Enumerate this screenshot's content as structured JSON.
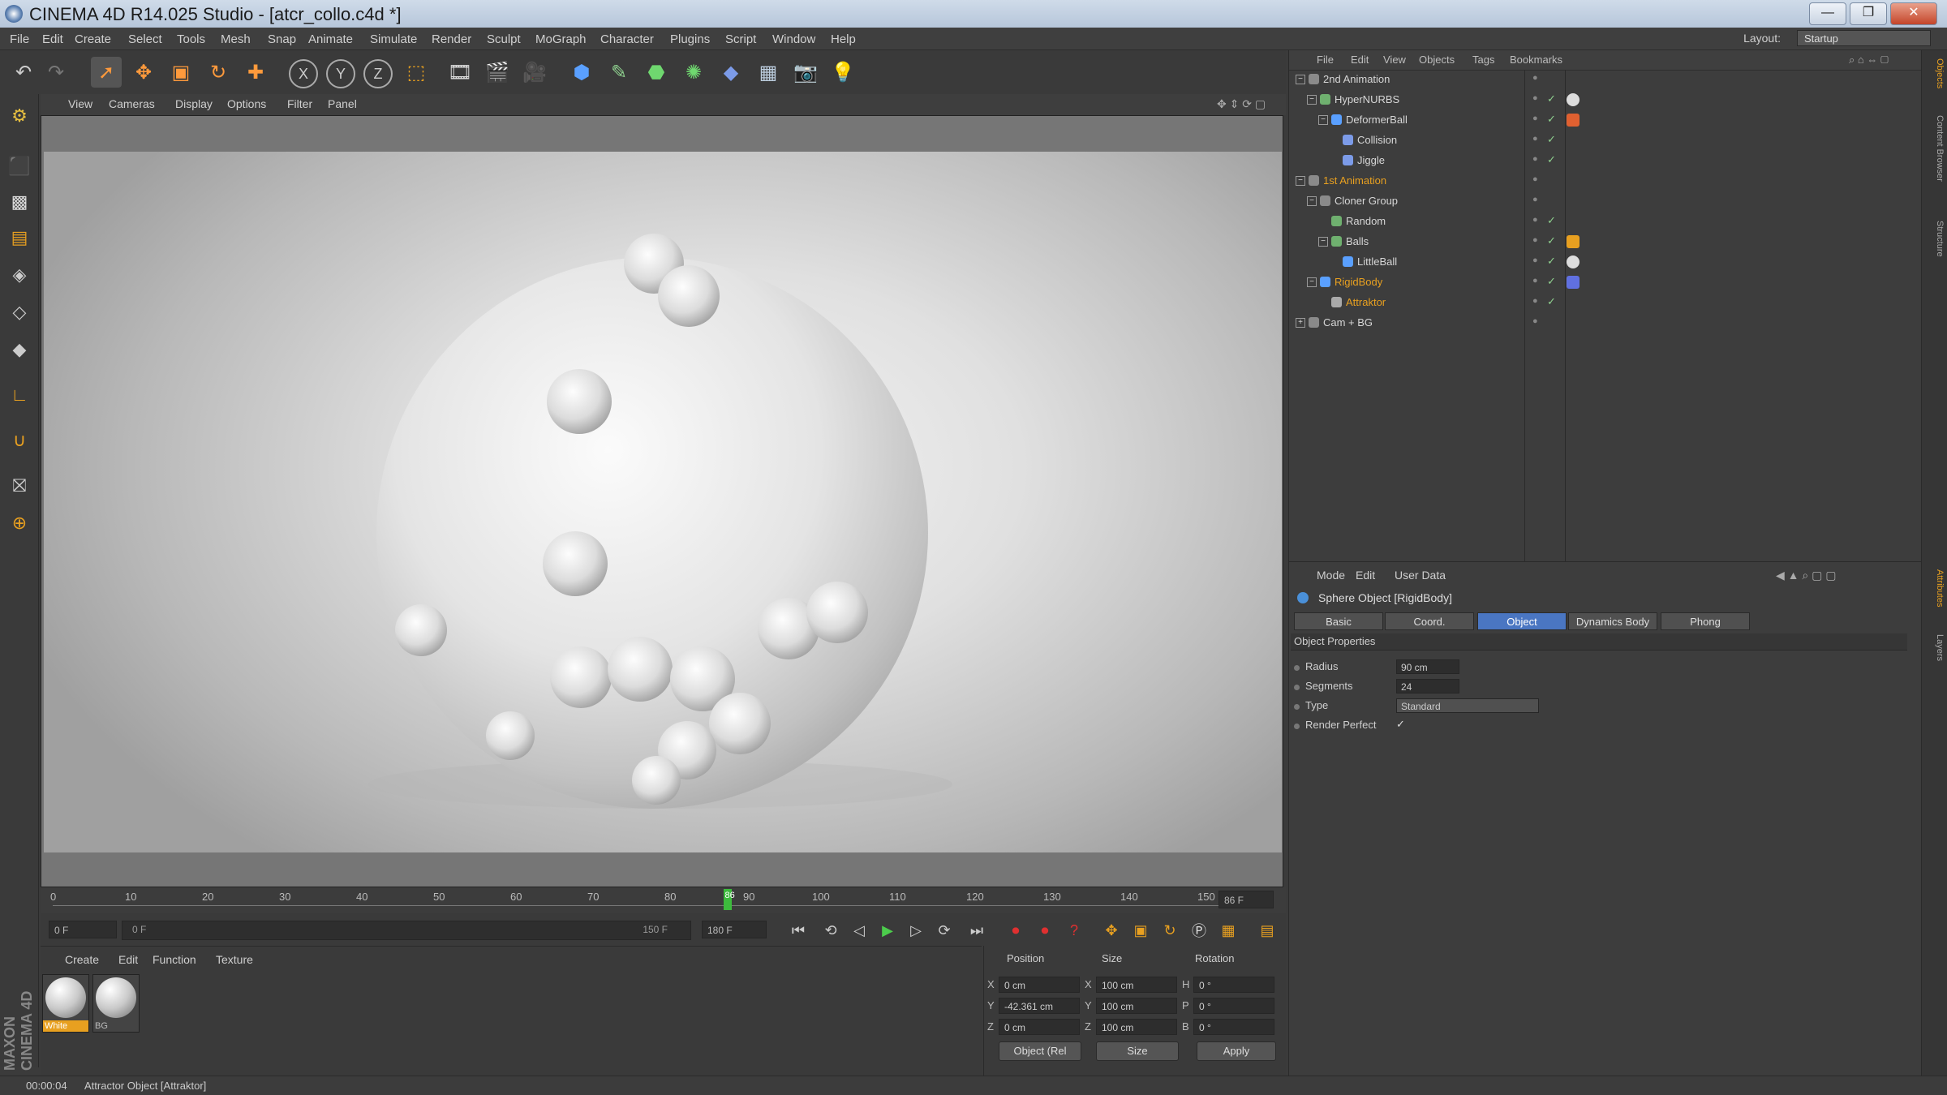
{
  "window": {
    "title": "CINEMA 4D R14.025 Studio - [atcr_collo.c4d *]",
    "minimize": "—",
    "maximize": "❐",
    "close": "✕"
  },
  "menubar": {
    "items": [
      "File",
      "Edit",
      "Create",
      "Select",
      "Tools",
      "Mesh",
      "Snap",
      "Animate",
      "Simulate",
      "Render",
      "Sculpt",
      "MoGraph",
      "Character",
      "Plugins",
      "Script",
      "Window",
      "Help"
    ],
    "layout_label": "Layout:",
    "layout_value": "Startup"
  },
  "viewport": {
    "menu": [
      "View",
      "Cameras",
      "Display",
      "Options",
      "Filter",
      "Panel"
    ]
  },
  "timeline": {
    "ticks": [
      "0",
      "10",
      "20",
      "30",
      "40",
      "50",
      "60",
      "70",
      "80",
      "86",
      "90",
      "100",
      "110",
      "120",
      "130",
      "140",
      "150"
    ],
    "current_frame_label": "86",
    "current_frame_fraction": 0.57,
    "end_field": "86 F",
    "start_field": "0 F",
    "range_start": "0 F",
    "range_end": "150 F",
    "max_field": "180 F"
  },
  "materials": {
    "menu": [
      "Create",
      "Edit",
      "Function",
      "Texture"
    ],
    "items": [
      {
        "label": "White",
        "selected": true
      },
      {
        "label": "BG",
        "selected": false
      }
    ]
  },
  "maxon_logo": "MAXON CINEMA 4D",
  "coordinates": {
    "headers": [
      "Position",
      "Size",
      "Rotation"
    ],
    "rows": [
      {
        "axis": "X",
        "pos": "0 cm",
        "size_axis": "X",
        "size": "100 cm",
        "rot_axis": "H",
        "rot": "0 °"
      },
      {
        "axis": "Y",
        "pos": "-42.361 cm",
        "size_axis": "Y",
        "size": "100 cm",
        "rot_axis": "P",
        "rot": "0 °"
      },
      {
        "axis": "Z",
        "pos": "0 cm",
        "size_axis": "Z",
        "size": "100 cm",
        "rot_axis": "B",
        "rot": "0 °"
      }
    ],
    "mode_select": "Object (Rel",
    "size_select": "Size",
    "apply": "Apply"
  },
  "status": {
    "time": "00:00:04",
    "message": "Attractor Object [Attraktor]"
  },
  "object_manager": {
    "menu": [
      "File",
      "Edit",
      "View",
      "Objects",
      "Tags",
      "Bookmarks"
    ],
    "rows": [
      {
        "label": "2nd Animation",
        "indent": 0,
        "expander": "−",
        "highlight": false
      },
      {
        "label": "HyperNURBS",
        "indent": 1,
        "expander": "−",
        "highlight": false
      },
      {
        "label": "DeformerBall",
        "indent": 2,
        "expander": "−",
        "highlight": false
      },
      {
        "label": "Collision",
        "indent": 3,
        "expander": "",
        "highlight": false
      },
      {
        "label": "Jiggle",
        "indent": 3,
        "expander": "",
        "highlight": false
      },
      {
        "label": "1st Animation",
        "indent": 0,
        "expander": "−",
        "highlight": true
      },
      {
        "label": "Cloner Group",
        "indent": 1,
        "expander": "−",
        "highlight": false
      },
      {
        "label": "Random",
        "indent": 2,
        "expander": "",
        "highlight": false
      },
      {
        "label": "Balls",
        "indent": 2,
        "expander": "−",
        "highlight": false
      },
      {
        "label": "LittleBall",
        "indent": 3,
        "expander": "",
        "highlight": false
      },
      {
        "label": "RigidBody",
        "indent": 1,
        "expander": "−",
        "highlight": true
      },
      {
        "label": "Attraktor",
        "indent": 2,
        "expander": "",
        "highlight": true
      },
      {
        "label": "Cam + BG",
        "indent": 0,
        "expander": "+",
        "highlight": false
      }
    ]
  },
  "attribute_manager": {
    "menu": [
      "Mode",
      "Edit",
      "User Data"
    ],
    "title": "Sphere Object [RigidBody]",
    "tabs": [
      {
        "label": "Basic",
        "active": false
      },
      {
        "label": "Coord.",
        "active": false
      },
      {
        "label": "Object",
        "active": true
      },
      {
        "label": "Dynamics Body",
        "active": false
      },
      {
        "label": "Phong",
        "active": false
      }
    ],
    "section": "Object Properties",
    "props": [
      {
        "label": "Radius",
        "value": "90 cm"
      },
      {
        "label": "Segments",
        "value": "24"
      },
      {
        "label": "Type",
        "value": "Standard"
      },
      {
        "label": "Render Perfect",
        "value": "✓"
      }
    ]
  },
  "right_tabs": [
    "Objects",
    "Content Browser",
    "Structure",
    "Attributes",
    "Layers"
  ],
  "colors": {
    "accent": "#4a76c2",
    "highlight_text": "#e8a020",
    "checkmark": "#8fd18f"
  }
}
